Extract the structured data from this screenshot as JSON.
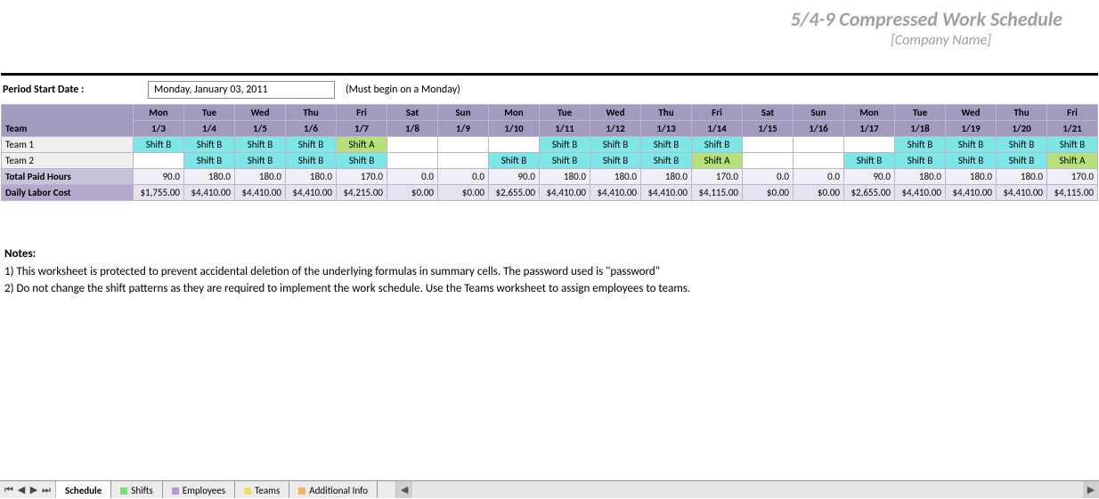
{
  "header": {
    "title": "5/4-9 Compressed Work Schedule",
    "subtitle": "[Company Name]"
  },
  "period": {
    "label": "Period Start Date :",
    "value": "Monday, January 03, 2011",
    "hint": "(Must begin on a Monday)"
  },
  "columns": {
    "team_header": "Team",
    "days": [
      "Mon",
      "Tue",
      "Wed",
      "Thu",
      "Fri",
      "Sat",
      "Sun",
      "Mon",
      "Tue",
      "Wed",
      "Thu",
      "Fri",
      "Sat",
      "Sun",
      "Mon",
      "Tue",
      "Wed",
      "Thu",
      "Fri"
    ],
    "dates": [
      "1/3",
      "1/4",
      "1/5",
      "1/6",
      "1/7",
      "1/8",
      "1/9",
      "1/10",
      "1/11",
      "1/12",
      "1/13",
      "1/14",
      "1/15",
      "1/16",
      "1/17",
      "1/18",
      "1/19",
      "1/20",
      "1/21"
    ]
  },
  "rows": {
    "team1": {
      "label": "Team 1",
      "cells": [
        "Shift B",
        "Shift B",
        "Shift B",
        "Shift B",
        "Shift A",
        "",
        "",
        "",
        "Shift B",
        "Shift B",
        "Shift B",
        "Shift B",
        "",
        "",
        "",
        "Shift B",
        "Shift B",
        "Shift B",
        "Shift B"
      ]
    },
    "team2": {
      "label": "Team 2",
      "cells": [
        "",
        "Shift B",
        "Shift B",
        "Shift B",
        "Shift B",
        "",
        "",
        "Shift B",
        "Shift B",
        "Shift B",
        "Shift B",
        "Shift A",
        "",
        "",
        "Shift B",
        "Shift B",
        "Shift B",
        "Shift B",
        "Shift A"
      ]
    },
    "hours": {
      "label": "Total Paid Hours",
      "cells": [
        "90.0",
        "180.0",
        "180.0",
        "180.0",
        "170.0",
        "0.0",
        "0.0",
        "90.0",
        "180.0",
        "180.0",
        "180.0",
        "170.0",
        "0.0",
        "0.0",
        "90.0",
        "180.0",
        "180.0",
        "180.0",
        "170.0"
      ]
    },
    "cost": {
      "label": "Daily Labor Cost",
      "cells": [
        "$1,755.00",
        "$4,410.00",
        "$4,410.00",
        "$4,410.00",
        "$4,215.00",
        "$0.00",
        "$0.00",
        "$2,655.00",
        "$4,410.00",
        "$4,410.00",
        "$4,410.00",
        "$4,115.00",
        "$0.00",
        "$0.00",
        "$2,655.00",
        "$4,410.00",
        "$4,410.00",
        "$4,410.00",
        "$4,115.00"
      ]
    }
  },
  "notes": {
    "heading": "Notes:",
    "line1": "1) This worksheet is protected to prevent accidental deletion of the underlying formulas in summary cells. The password used is \"password\"",
    "line2": "2) Do not change the shift patterns as they are required to implement the work schedule.  Use the Teams worksheet to assign employees to teams."
  },
  "tabs": {
    "nav_first": "⏮",
    "nav_prev": "◀",
    "nav_next": "▶",
    "nav_last": "⏭",
    "items": [
      "Schedule",
      "Shifts",
      "Employees",
      "Teams",
      "Additional Info"
    ],
    "scroll_left": "◀",
    "scroll_right": "▶"
  }
}
